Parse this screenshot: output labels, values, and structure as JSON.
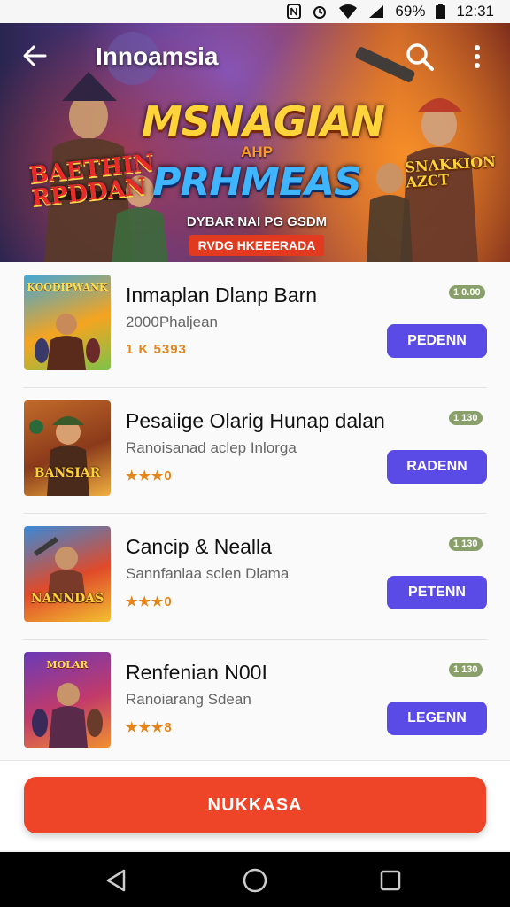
{
  "status_bar": {
    "battery": "69%",
    "time": "12:31"
  },
  "header": {
    "title": "Innoamsia"
  },
  "banner": {
    "headline_1": "MSNAGIAN",
    "headline_2": "AHP",
    "headline_3": "PRHMEAS",
    "tagline": "DYBAR NAI PG GSDM",
    "ribbon": "RVDG HKEEERADA",
    "left_sign": "BAETHIN\nRPDDAN",
    "right_sign": "SNAKKION\nAZCT"
  },
  "items": [
    {
      "title": "Inmaplan Dlanp Barn",
      "subtitle": "2000Phaljean",
      "rating": "1 K 5393",
      "badge": "1 0.00",
      "button": "PEDENN",
      "thumb_top": "KOODIPWANK",
      "thumb_label": "",
      "thumb_colors": [
        "#3fa8d8",
        "#7ec24a",
        "#f5a420"
      ]
    },
    {
      "title": "Pesaiige Olarig Hunap dalan",
      "subtitle": "Ranoisanad aclep Inlorga",
      "rating": "★★★0",
      "badge": "1 130",
      "button": "RADENN",
      "thumb_top": "",
      "thumb_label": "BANSIAR",
      "thumb_colors": [
        "#c26a2a",
        "#8a3a1a",
        "#f0b040"
      ]
    },
    {
      "title": "Cancip & Nealla",
      "subtitle": "Sannfanlaa sclen Dlama",
      "rating": "★★★0",
      "badge": "1 130",
      "button": "PETENN",
      "thumb_top": "",
      "thumb_label": "NANNDAS",
      "thumb_colors": [
        "#3a8ad8",
        "#e04a2a",
        "#f2c030"
      ]
    },
    {
      "title": "Renfenian N00I",
      "subtitle": "Ranoiarang Sdean",
      "rating": "★★★8",
      "badge": "1 130",
      "button": "LEGENN",
      "thumb_top": "MOLAR",
      "thumb_label": "",
      "thumb_colors": [
        "#6a3ab8",
        "#c23a6a",
        "#f09030"
      ]
    }
  ],
  "primary_action": {
    "label": "NUKKASA"
  },
  "colors": {
    "accent": "#5b4be6",
    "primary": "#ee4428",
    "star": "#e3851b"
  }
}
